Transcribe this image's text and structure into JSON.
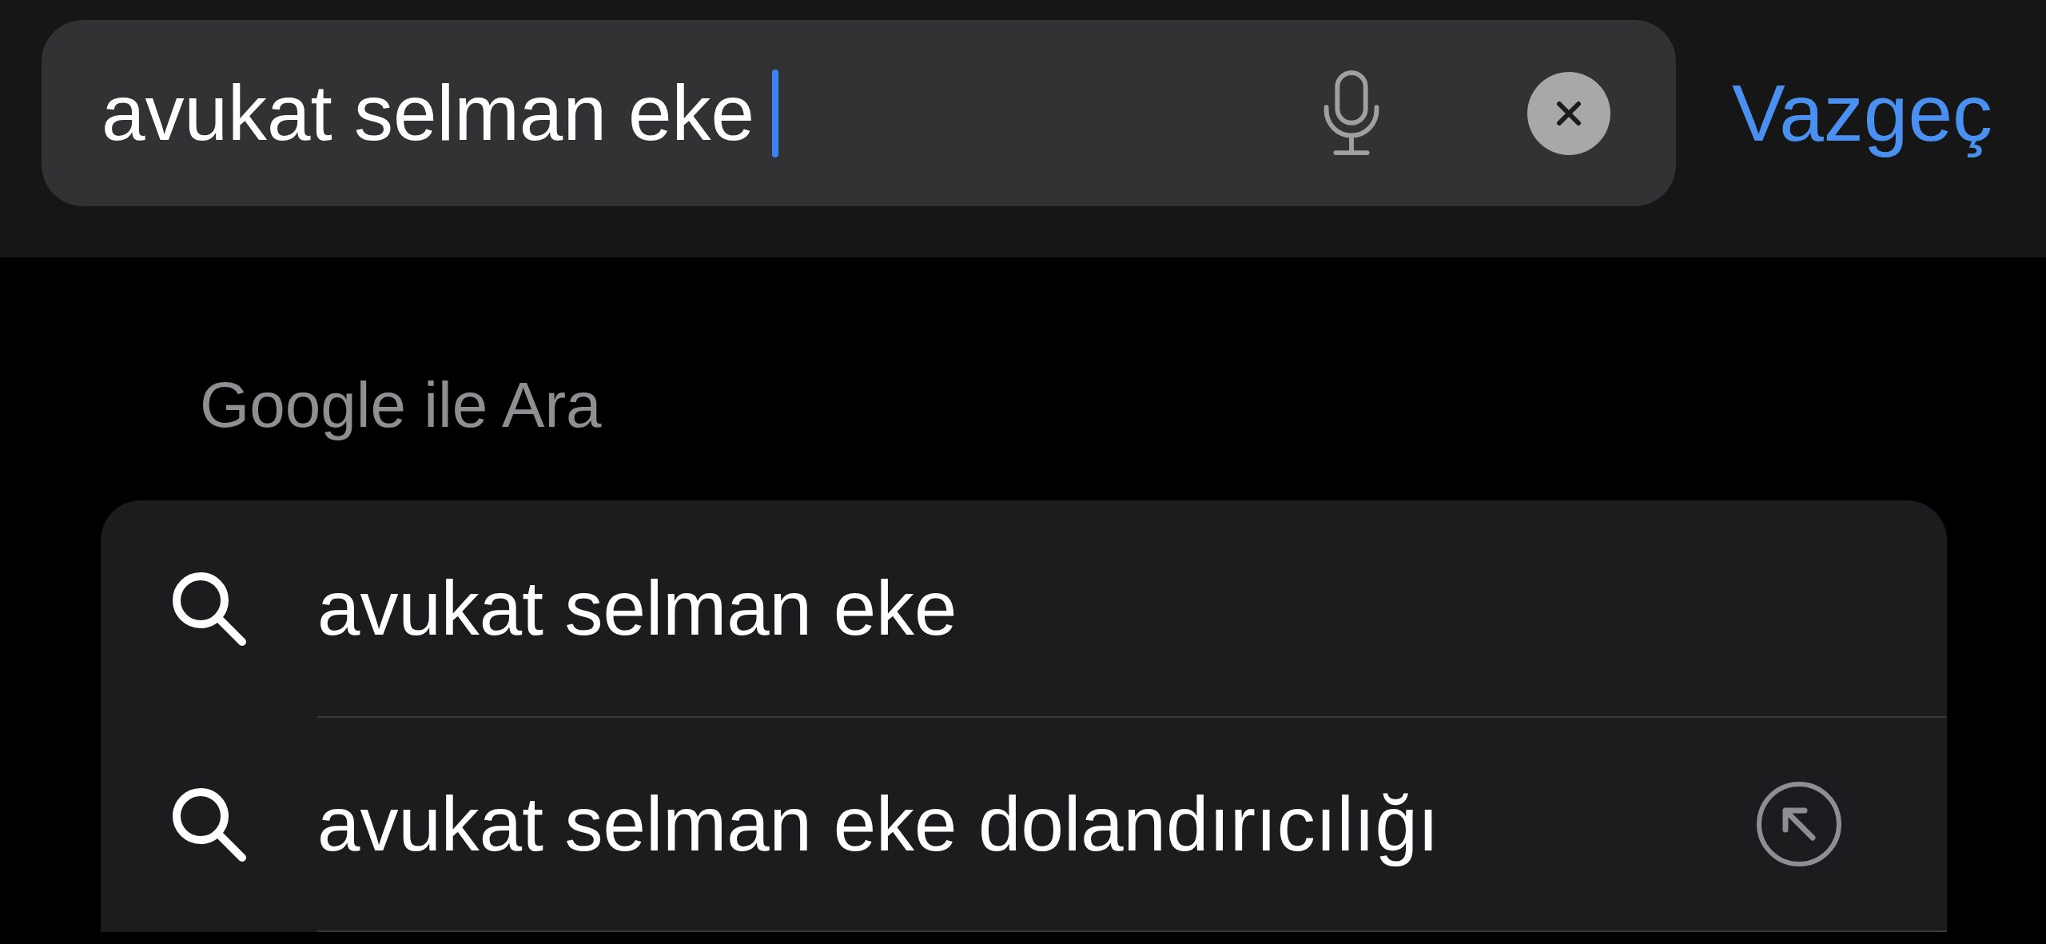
{
  "search_bar": {
    "value": "avukat selman eke",
    "focused": true
  },
  "cancel_button": "Vazgeç",
  "section_title": "Google ile Ara",
  "suggestions": [
    {
      "text": "avukat selman eke",
      "fill_button": false
    },
    {
      "text": "avukat selman eke dolandırıcılığı",
      "fill_button": true
    }
  ]
}
